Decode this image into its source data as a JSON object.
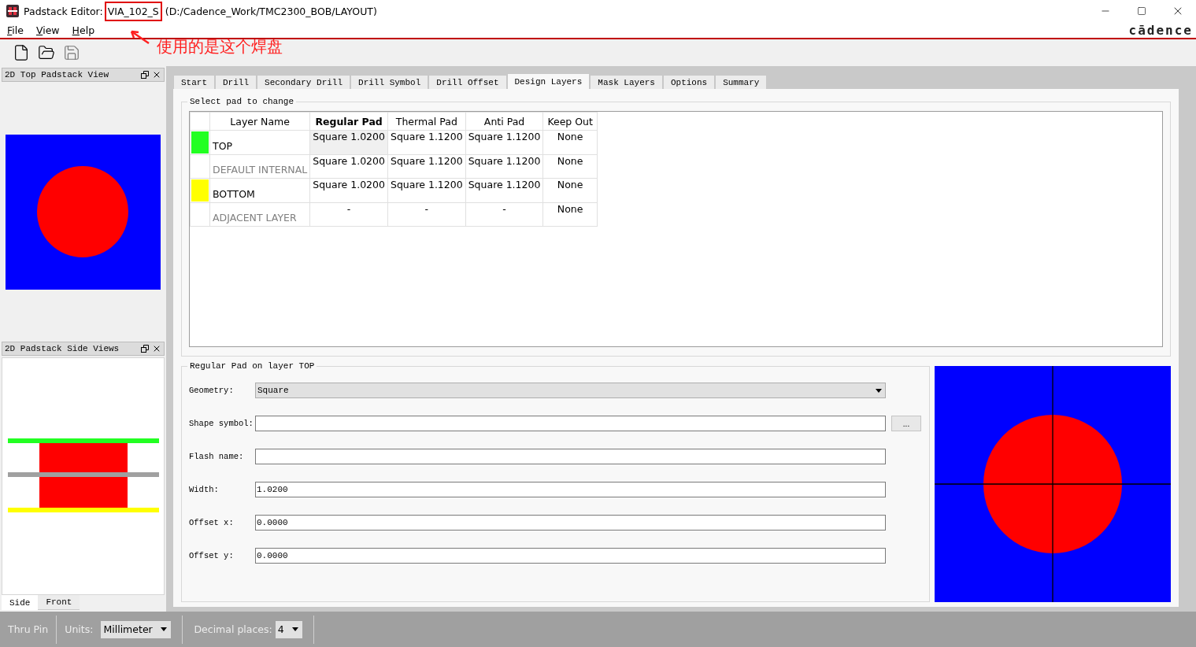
{
  "window": {
    "title_prefix": "Padstack Editor:",
    "design_name": "VIA_102_S",
    "path": "(D:/Cadence_Work/TMC2300_BOB/LAYOUT)"
  },
  "menu": [
    "File",
    "View",
    "Help"
  ],
  "logo": "cādence",
  "annotation": {
    "text": "使用的是这个焊盘"
  },
  "top_view": {
    "title": "2D Top Padstack View"
  },
  "side_view": {
    "title": "2D Padstack Side Views",
    "tabs": [
      {
        "label": "Side",
        "selected": true
      },
      {
        "label": "Front",
        "selected": false
      }
    ]
  },
  "tabs": [
    {
      "label": "Start",
      "selected": false
    },
    {
      "label": "Drill",
      "selected": false
    },
    {
      "label": "Secondary Drill",
      "selected": false
    },
    {
      "label": "Drill Symbol",
      "selected": false
    },
    {
      "label": "Drill Offset",
      "selected": false
    },
    {
      "label": "Design Layers",
      "selected": true
    },
    {
      "label": "Mask Layers",
      "selected": false
    },
    {
      "label": "Options",
      "selected": false
    },
    {
      "label": "Summary",
      "selected": false
    }
  ],
  "pad_table": {
    "group_title": "Select pad to change",
    "columns": [
      {
        "label": "Layer Name",
        "selected": false
      },
      {
        "label": "Regular Pad",
        "selected": true
      },
      {
        "label": "Thermal Pad",
        "selected": false
      },
      {
        "label": "Anti Pad",
        "selected": false
      },
      {
        "label": "Keep Out",
        "selected": false
      }
    ],
    "rows": [
      {
        "color": "#22ff22",
        "disabled": false,
        "selected": true,
        "cells": [
          "TOP",
          "Square 1.0200",
          "Square 1.1200",
          "Square 1.1200",
          "None"
        ]
      },
      {
        "disabled": true,
        "selected": false,
        "cells": [
          "DEFAULT INTERNAL",
          "Square 1.0200",
          "Square 1.1200",
          "Square 1.1200",
          "None"
        ]
      },
      {
        "color": "#ffff00",
        "disabled": false,
        "selected": false,
        "cells": [
          "BOTTOM",
          "Square 1.0200",
          "Square 1.1200",
          "Square 1.1200",
          "None"
        ]
      },
      {
        "disabled": true,
        "selected": false,
        "cells": [
          "ADJACENT LAYER",
          "-",
          "-",
          "-",
          "None"
        ]
      }
    ]
  },
  "pad_form": {
    "group_title": "Regular Pad on layer TOP",
    "fields": [
      {
        "kind": "dropdown",
        "label": "Geometry:",
        "value": "Square"
      },
      {
        "kind": "browse",
        "label": "Shape symbol:",
        "button": "..."
      },
      {
        "kind": "text",
        "label": "Flash name:"
      },
      {
        "kind": "text",
        "label": "Width:",
        "value": "1.0200"
      },
      {
        "kind": "text",
        "label": "Offset x:",
        "value": "0.0000"
      },
      {
        "kind": "text",
        "label": "Offset y:",
        "value": "0.0000"
      }
    ]
  },
  "status_bar": {
    "mode": "Thru Pin",
    "units_label": "Units:",
    "units": "Millimeter",
    "decimal_label": "Decimal places:",
    "decimal": "4"
  }
}
